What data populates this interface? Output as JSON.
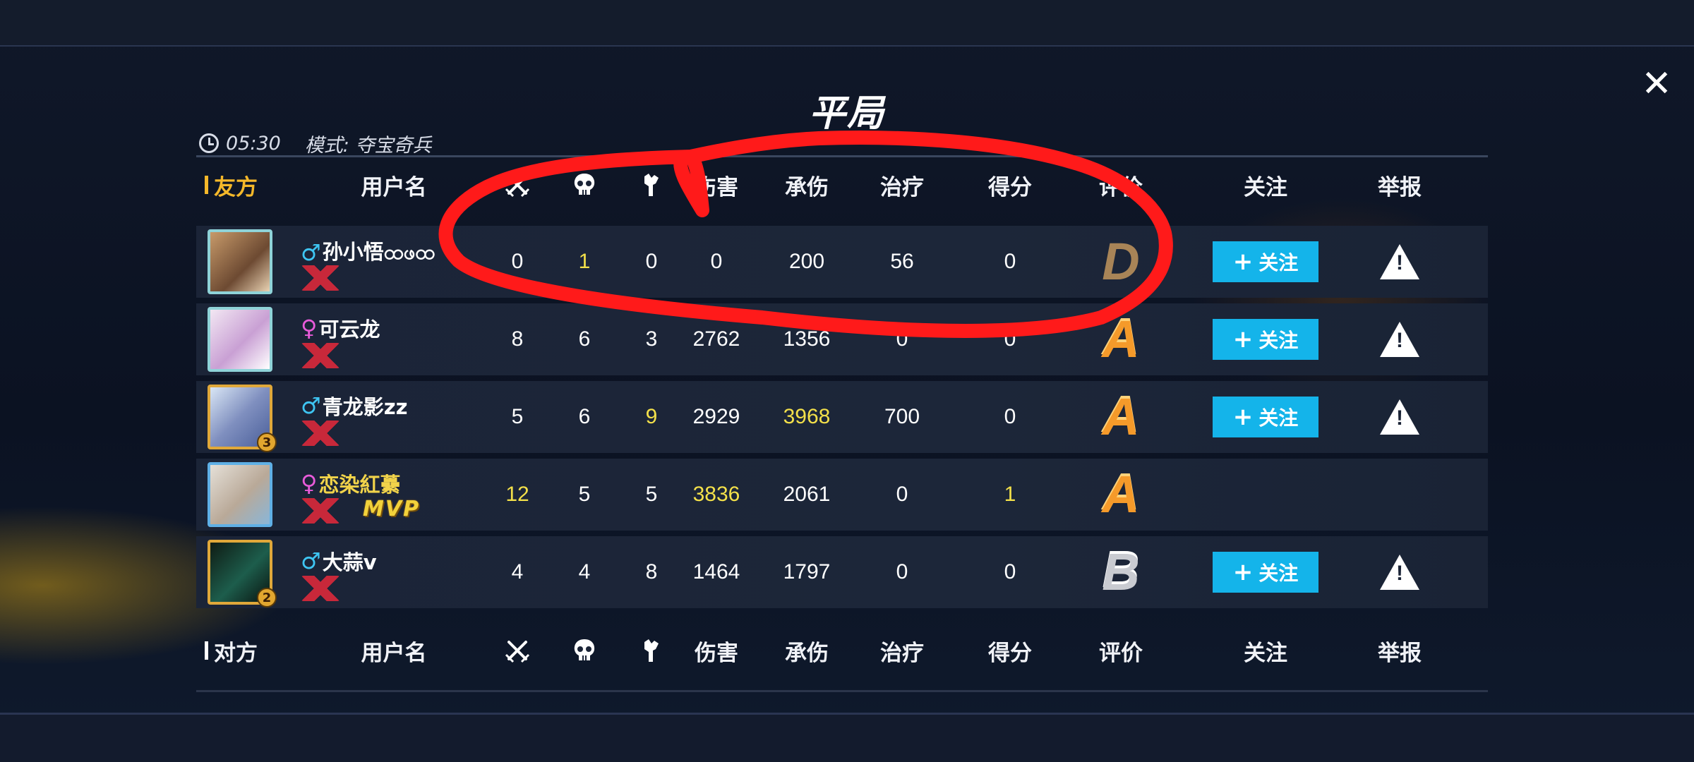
{
  "header": {
    "title": "平局",
    "time": "05:30",
    "mode": "模式: 夺宝奇兵"
  },
  "columns": {
    "ally_team": "友方",
    "enemy_team": "对方",
    "username": "用户名",
    "kills_icon": "crossed-swords-icon",
    "deaths_icon": "skull-icon",
    "assists_icon": "fist-icon",
    "damage": "伤害",
    "damage_taken": "承伤",
    "healing": "治疗",
    "score": "得分",
    "rating": "评价",
    "follow": "关注",
    "report": "举报"
  },
  "follow_button_label": "关注",
  "players": [
    {
      "gender": "♂",
      "name": "孙小悟ထဖထ",
      "kills": "0",
      "deaths": "1",
      "assists": "0",
      "damage": "0",
      "taken": "200",
      "heal": "56",
      "score": "0",
      "rating": "D",
      "follow": true,
      "mvp": false
    },
    {
      "gender": "♀",
      "name": "可云龙",
      "kills": "8",
      "deaths": "6",
      "assists": "3",
      "damage": "2762",
      "taken": "1356",
      "heal": "0",
      "score": "0",
      "rating": "A",
      "follow": true,
      "mvp": false
    },
    {
      "gender": "♂",
      "name": "青龙影zz",
      "kills": "5",
      "deaths": "6",
      "assists": "9",
      "damage": "2929",
      "taken": "3968",
      "heal": "700",
      "score": "0",
      "rating": "A",
      "follow": true,
      "mvp": false,
      "badge": "3"
    },
    {
      "gender": "♀",
      "name": "恋染紅虆",
      "kills": "12",
      "deaths": "5",
      "assists": "5",
      "damage": "3836",
      "taken": "2061",
      "heal": "0",
      "score": "1",
      "rating": "A",
      "follow": false,
      "mvp": true,
      "mvp_label": "MVP"
    },
    {
      "gender": "♂",
      "name": "大蒜v",
      "kills": "4",
      "deaths": "4",
      "assists": "8",
      "damage": "1464",
      "taken": "1797",
      "heal": "0",
      "score": "0",
      "rating": "B",
      "follow": true,
      "mvp": false,
      "badge": "2"
    }
  ],
  "colors": {
    "accent_gold": "#f5b82a",
    "highlight_yellow": "#f3e04a",
    "follow_blue": "#14b4ea",
    "annotation_red": "#ff1a1a"
  }
}
